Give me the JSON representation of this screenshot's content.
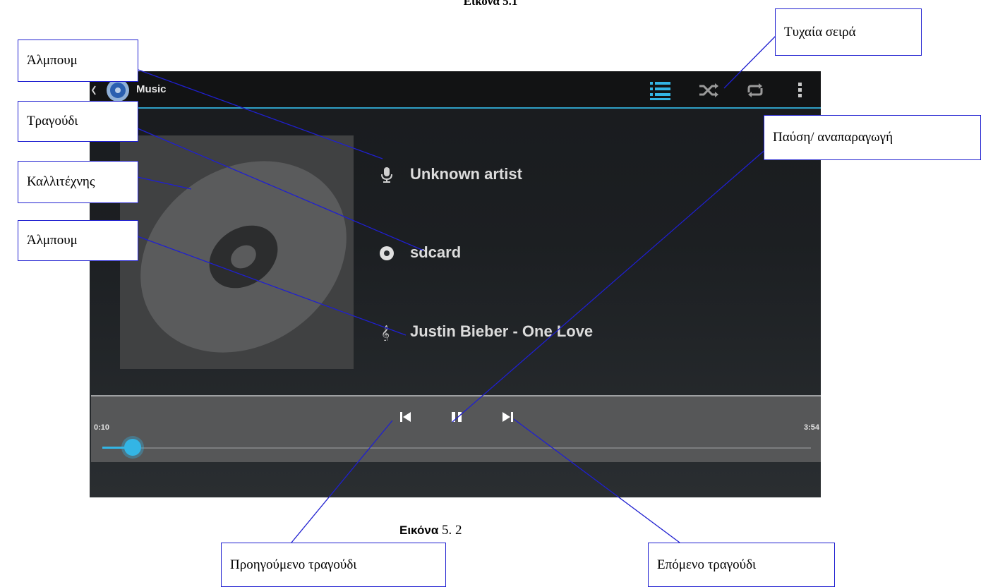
{
  "top_caption": "Εικόνα 5.1",
  "bottom_caption": {
    "prefix": "Εικόνα",
    "number": "5. 2"
  },
  "app": {
    "title": "Music",
    "icons": [
      "back-caret-icon",
      "music-app-icon",
      "now-playing-list-icon",
      "shuffle-icon",
      "repeat-icon",
      "overflow-menu-icon"
    ],
    "accent_color": "#33b5e5"
  },
  "track": {
    "artist": "Unknown artist",
    "album": "sdcard",
    "song": "Justin Bieber - One Love",
    "elapsed": "0:10",
    "duration": "3:54",
    "progress_fraction": 0.043
  },
  "callouts": {
    "album_top": "Άλμπουμ",
    "song": "Τραγούδι",
    "artist": "Καλλιτέχνης",
    "album_bottom": "Άλμπουμ",
    "shuffle": "Τυχαία σειρά",
    "pause_play": "Παύση/ αναπαραγωγή",
    "previous": "Προηγούμενο τραγούδι",
    "next": "Επόμενο τραγούδι"
  },
  "colors": {
    "callout_line": "#1f1fd0"
  }
}
